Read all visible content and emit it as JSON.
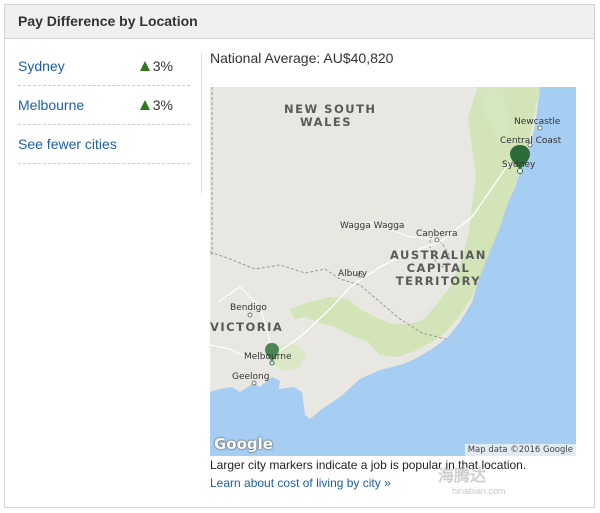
{
  "panel": {
    "title": "Pay Difference by Location"
  },
  "cities": [
    {
      "name": "Sydney",
      "change": "3%"
    },
    {
      "name": "Melbourne",
      "change": "3%"
    }
  ],
  "see_fewer_label": "See fewer cities",
  "national_average": "National Average: AU$40,820",
  "map": {
    "regions": {
      "nsw_line1": "NEW SOUTH",
      "nsw_line2": "WALES",
      "act_line1": "AUSTRALIAN",
      "act_line2": "CAPITAL",
      "act_line3": "TERRITORY",
      "victoria": "VICTORIA"
    },
    "places": {
      "newcastle": "Newcastle",
      "central_coast": "Central Coast",
      "sydney": "Sydney",
      "wagga_wagga": "Wagga Wagga",
      "canberra": "Canberra",
      "albury": "Albury",
      "bendigo": "Bendigo",
      "melbourne": "Melbourne",
      "geelong": "Geelong"
    },
    "logo": "Google",
    "attribution": "Map data ©2016 Google"
  },
  "note": "Larger city markers indicate a job is popular in that location.",
  "learn_link": "Learn about cost of living by city »",
  "watermark": {
    "text": "海腾达",
    "sub": "hinabian.com"
  },
  "colors": {
    "link": "#1e5fa8",
    "increase": "#2d7a1e",
    "ocean": "#a6cdf2",
    "land": "#e9e7e1",
    "forest": "#cfe3b4",
    "marker": "#2e6b3a"
  },
  "icons": {
    "increase": "triangle-up-icon",
    "marker": "map-pin-icon"
  }
}
